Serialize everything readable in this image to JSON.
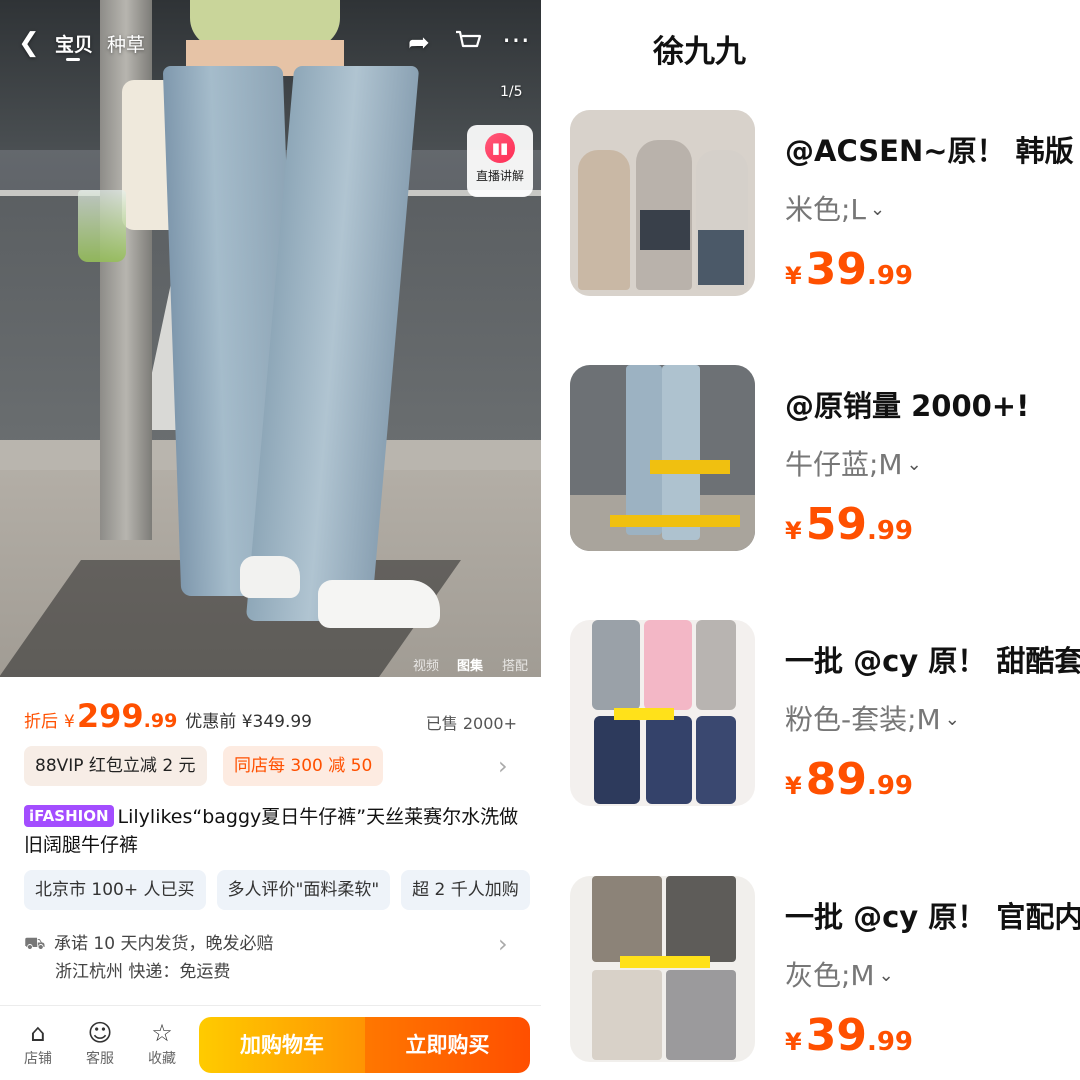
{
  "left": {
    "nav": {
      "back_icon": "chevron-left-icon",
      "tabs": [
        "宝贝",
        "种草"
      ],
      "share_icon": "share-icon",
      "cart_icon": "cart-icon",
      "more_icon": "more-icon",
      "image_counter": "1/5",
      "live_label": "直播讲解",
      "media_tabs": [
        "视频",
        "图集",
        "搭配"
      ],
      "active_media_tab": "图集"
    },
    "price": {
      "prefix": "折后",
      "currency": "¥",
      "integer": "299",
      "decimal": ".99",
      "original": "优惠前 ¥349.99",
      "sold": "已售 2000+"
    },
    "coupons": [
      "88VIP 红包立减 2 元",
      "同店每 300 减 50"
    ],
    "title": {
      "badge": "iFASHION",
      "text": "Lilylikes“baggy夏日牛仔裤”天丝莱赛尔水洗做旧阔腿牛仔裤"
    },
    "chips": [
      "北京市 100+ 人已买",
      "多人评价\"面料柔软\"",
      "超 2 千人加购"
    ],
    "shipping": {
      "line1": "承诺 10 天内发货，晚发必赔",
      "line2": "浙江杭州  快递：免运费"
    },
    "bottom_bar": {
      "shop": "店铺",
      "service": "客服",
      "favorite": "收藏",
      "add_to_cart": "加购物车",
      "buy_now": "立即购买"
    }
  },
  "right": {
    "title": "徐九九",
    "items": [
      {
        "title": "@ACSEN~原！ 韩版",
        "sku": "米色;L",
        "yen": "¥",
        "int": "39",
        "dec": ".99"
      },
      {
        "title": "@原销量 2000+!",
        "sku": "牛仔蓝;M",
        "yen": "¥",
        "int": "59",
        "dec": ".99"
      },
      {
        "title": "一批 @cy 原！ 甜酷套",
        "sku": "粉色-套装;M",
        "yen": "¥",
        "int": "89",
        "dec": ".99"
      },
      {
        "title": "一批 @cy 原！ 官配内",
        "sku": "灰色;M",
        "yen": "¥",
        "int": "39",
        "dec": ".99"
      }
    ]
  },
  "colors": {
    "accent_orange": "#ff5000",
    "cart_button": "#ff9402",
    "buy_button": "#ff4f00",
    "badge_purple": "#a34dff"
  }
}
